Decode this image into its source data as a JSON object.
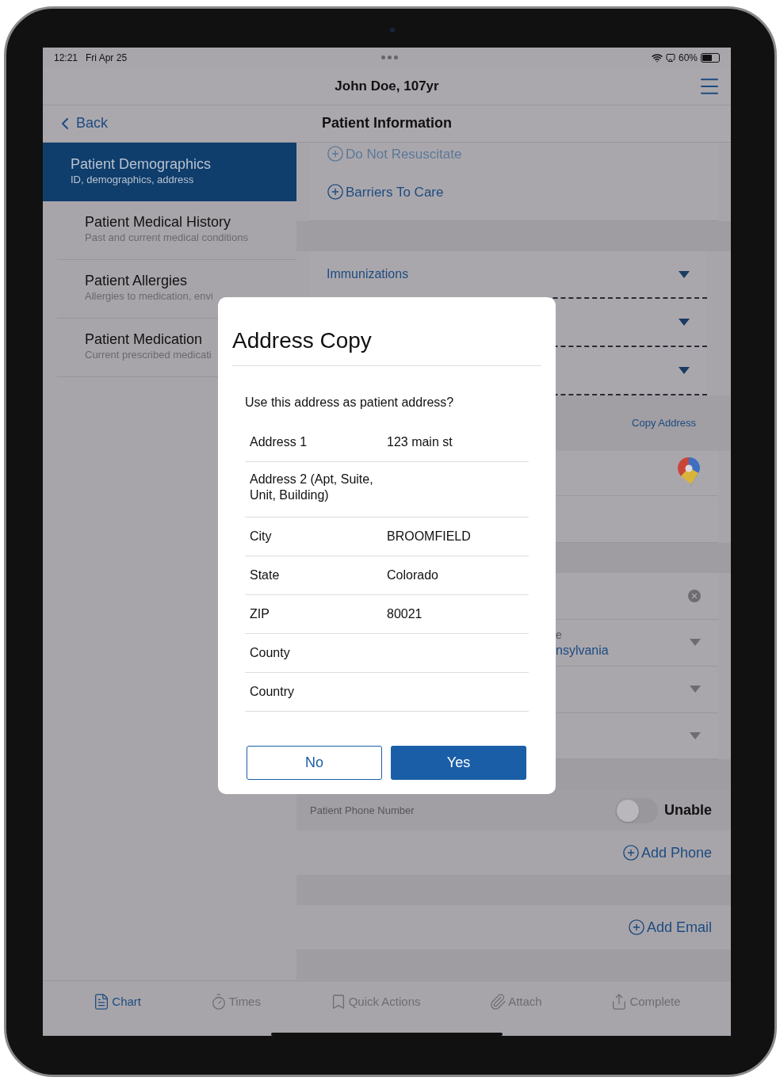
{
  "status_bar": {
    "time": "12:21",
    "date": "Fri Apr 25",
    "battery": "60%"
  },
  "header": {
    "title": "John Doe, 107yr"
  },
  "nav": {
    "back": "Back",
    "title": "Patient Information"
  },
  "sidebar": {
    "items": [
      {
        "title": "Patient Demographics",
        "subtitle": "ID, demographics, address",
        "selected": true
      },
      {
        "title": "Patient Medical History",
        "subtitle": "Past and current medical conditions",
        "selected": false
      },
      {
        "title": "Patient Allergies",
        "subtitle": "Allergies to medication, envi",
        "selected": false
      },
      {
        "title": "Patient Medication",
        "subtitle": "Current prescribed medicati",
        "selected": false
      }
    ]
  },
  "content": {
    "rows": [
      {
        "kind": "add",
        "label": "Do Not Resuscitate",
        "faded": true
      },
      {
        "kind": "add",
        "label": "Barriers To Care",
        "faded": false
      },
      {
        "kind": "gap"
      },
      {
        "kind": "dropdown",
        "label": "Immunizations"
      },
      {
        "kind": "dropdown"
      },
      {
        "kind": "dropdown"
      },
      {
        "kind": "link",
        "label": "Copy Address"
      },
      {
        "kind": "map"
      },
      {
        "kind": "blank"
      },
      {
        "kind": "gap"
      },
      {
        "kind": "clear"
      },
      {
        "kind": "select",
        "label": "e",
        "value": "nsylvania"
      },
      {
        "kind": "select"
      },
      {
        "kind": "select"
      },
      {
        "kind": "gap"
      },
      {
        "kind": "toggle",
        "label": "Patient Phone Number",
        "option": "Unable",
        "on": false
      },
      {
        "kind": "add_right",
        "label": "Add Phone"
      },
      {
        "kind": "gap"
      },
      {
        "kind": "add_right",
        "label": "Add Email"
      },
      {
        "kind": "gap"
      }
    ]
  },
  "dialog": {
    "title": "Address Copy",
    "question": "Use this address as patient address?",
    "fields": [
      {
        "label": "Address 1",
        "value": "123 main st"
      },
      {
        "label": "Address 2 (Apt, Suite, Unit, Building)"
      },
      {
        "label": "City",
        "value": "BROOMFIELD"
      },
      {
        "label": "State",
        "value": "Colorado"
      },
      {
        "label": "ZIP",
        "value": "80021"
      },
      {
        "label": "County"
      },
      {
        "label": "Country"
      }
    ],
    "buttons": [
      {
        "label": "No",
        "kind": "secondary"
      },
      {
        "label": "Yes",
        "kind": "primary"
      }
    ]
  },
  "tab_bar": {
    "tabs": [
      {
        "label": "Chart",
        "selected": true
      },
      {
        "label": "Times",
        "selected": false
      },
      {
        "label": "Quick Actions",
        "selected": false
      },
      {
        "label": "Attach",
        "selected": false
      },
      {
        "label": "Complete",
        "selected": false
      }
    ]
  }
}
